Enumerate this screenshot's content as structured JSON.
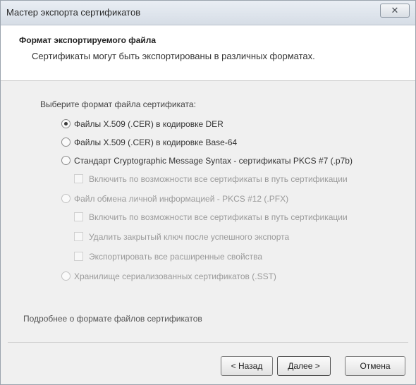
{
  "window": {
    "title": "Мастер экспорта сертификатов",
    "close_glyph": "✕"
  },
  "header": {
    "title": "Формат экспортируемого файла",
    "description": "Сертификаты могут быть экспортированы в различных форматах."
  },
  "content": {
    "prompt": "Выберите формат файла сертификата:",
    "options": [
      {
        "label": "Файлы X.509 (.CER) в кодировке DER",
        "selected": true,
        "enabled": true
      },
      {
        "label": "Файлы X.509 (.CER) в кодировке Base-64",
        "selected": false,
        "enabled": true
      },
      {
        "label": "Стандарт Cryptographic Message Syntax - сертификаты PKCS #7 (.p7b)",
        "selected": false,
        "enabled": true
      },
      {
        "label": "Файл обмена личной информацией - PKCS #12 (.PFX)",
        "selected": false,
        "enabled": false
      },
      {
        "label": "Хранилище сериализованных сертификатов (.SST)",
        "selected": false,
        "enabled": false
      }
    ],
    "p7b_checkbox": "Включить по возможности все сертификаты в путь сертификации",
    "pfx_checkboxes": [
      "Включить по возможности все сертификаты в путь сертификации",
      "Удалить закрытый ключ после успешного экспорта",
      "Экспортировать все расширенные свойства"
    ],
    "help_link": "Подробнее о формате файлов сертификатов"
  },
  "buttons": {
    "back": "< Назад",
    "next": "Далее >",
    "cancel": "Отмена"
  }
}
